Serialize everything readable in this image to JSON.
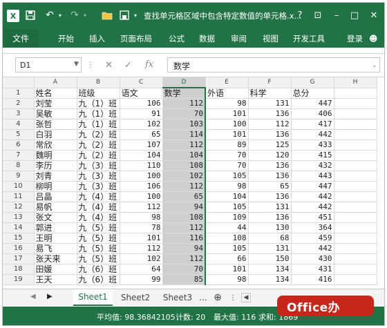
{
  "window": {
    "title": "查找单元格区域中包含特定数值的单元格.x...",
    "app_icon": "excel-icon",
    "controls": [
      "?",
      "⊡",
      "–",
      "□",
      "✕"
    ]
  },
  "ribbon": {
    "file_tab": "文件",
    "tabs": [
      "开始",
      "插入",
      "页面布局",
      "公式",
      "数据",
      "审阅",
      "视图",
      "开发工具"
    ],
    "login": "登录"
  },
  "formula_bar": {
    "name_box": "D1",
    "fx": "fx",
    "content": "数学"
  },
  "columns": [
    "A",
    "B",
    "C",
    "D",
    "E",
    "F",
    "G",
    "H"
  ],
  "selected_column": "D",
  "rows": [
    {
      "n": "1",
      "A": "姓名",
      "B": "班级",
      "C": "语文",
      "D": "数学",
      "E": "外语",
      "F": "科学",
      "G": "总分",
      "header": true
    },
    {
      "n": "2",
      "A": "刘莹",
      "B": "九（1）班",
      "C": "106",
      "D": "112",
      "E": "98",
      "F": "131",
      "G": "447"
    },
    {
      "n": "3",
      "A": "吴敏",
      "B": "九（1）班",
      "C": "91",
      "D": "70",
      "E": "101",
      "F": "136",
      "G": "406"
    },
    {
      "n": "4",
      "A": "张哲",
      "B": "九（1）班",
      "C": "102",
      "D": "103",
      "E": "100",
      "F": "112",
      "G": "417"
    },
    {
      "n": "5",
      "A": "白羽",
      "B": "九（2）班",
      "C": "65",
      "D": "114",
      "E": "101",
      "F": "136",
      "G": "442"
    },
    {
      "n": "6",
      "A": "常欣",
      "B": "九（2）班",
      "C": "107",
      "D": "112",
      "E": "89",
      "F": "125",
      "G": "433"
    },
    {
      "n": "7",
      "A": "魏明",
      "B": "九（2）班",
      "C": "104",
      "D": "104",
      "E": "70",
      "F": "120",
      "G": "415"
    },
    {
      "n": "8",
      "A": "李历",
      "B": "九（3）班",
      "C": "110",
      "D": "108",
      "E": "70",
      "F": "136",
      "G": "432"
    },
    {
      "n": "9",
      "A": "刘青",
      "B": "九（3）班",
      "C": "100",
      "D": "102",
      "E": "105",
      "F": "136",
      "G": "443"
    },
    {
      "n": "10",
      "A": "柳明",
      "B": "九（3）班",
      "C": "106",
      "D": "112",
      "E": "98",
      "F": "65",
      "G": "447"
    },
    {
      "n": "11",
      "A": "吕晶",
      "B": "九（4）班",
      "C": "100",
      "D": "65",
      "E": "104",
      "F": "136",
      "G": "442"
    },
    {
      "n": "12",
      "A": "易帆",
      "B": "九（4）班",
      "C": "112",
      "D": "94",
      "E": "105",
      "F": "131",
      "G": "442"
    },
    {
      "n": "13",
      "A": "张文",
      "B": "九（4）班",
      "C": "98",
      "D": "108",
      "E": "109",
      "F": "136",
      "G": "451"
    },
    {
      "n": "14",
      "A": "郭进",
      "B": "九（5）班",
      "C": "78",
      "D": "112",
      "E": "44",
      "F": "130",
      "G": "364"
    },
    {
      "n": "15",
      "A": "王明",
      "B": "九（5）班",
      "C": "101",
      "D": "116",
      "E": "108",
      "F": "68",
      "G": "459"
    },
    {
      "n": "16",
      "A": "易飞",
      "B": "九（5）班",
      "C": "112",
      "D": "94",
      "E": "105",
      "F": "131",
      "G": "442"
    },
    {
      "n": "17",
      "A": "张天来",
      "B": "九（5）班",
      "C": "102",
      "D": "112",
      "E": "66",
      "F": "150",
      "G": "430"
    },
    {
      "n": "18",
      "A": "田媛",
      "B": "九（6）班",
      "C": "64",
      "D": "70",
      "E": "101",
      "F": "134",
      "G": "431"
    },
    {
      "n": "19",
      "A": "王天",
      "B": "九（6）班",
      "C": "99",
      "D": "85",
      "E": "98",
      "F": "134",
      "G": "416"
    }
  ],
  "sheets": {
    "tabs": [
      "Sheet1",
      "Sheet2",
      "Sheet3",
      "..."
    ],
    "active": "Sheet1"
  },
  "status": {
    "average": "平均值: 98.36842105",
    "count": "计数: 20",
    "max": "最大值: 116",
    "sum": "求和: 1869"
  },
  "watermark": "Office办"
}
